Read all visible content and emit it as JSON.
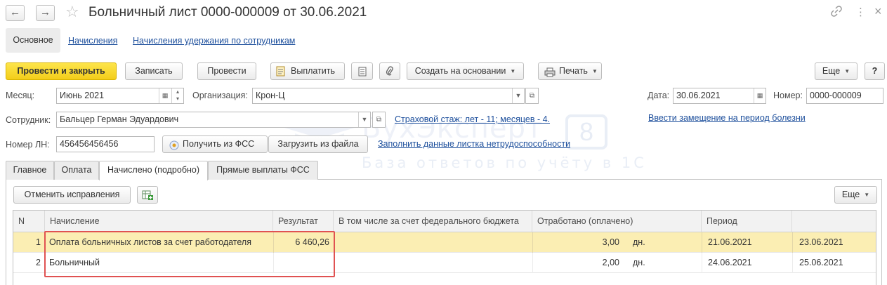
{
  "window": {
    "title": "Больничный лист 0000-000009 от 30.06.2021",
    "icons": [
      "back-arrow-icon",
      "forward-arrow-icon",
      "star-icon",
      "link-icon",
      "more-vertical-icon",
      "close-icon"
    ],
    "back_glyph": "←",
    "forward_glyph": "→",
    "star_glyph": "☆",
    "link_glyph": "🔗",
    "more_glyph": "⋮",
    "close_glyph": "×"
  },
  "sections": {
    "main": "Основное",
    "links": [
      "Начисления",
      "Начисления удержания по сотрудникам"
    ]
  },
  "toolbar": {
    "post_close": "Провести и закрыть",
    "save": "Записать",
    "post": "Провести",
    "pay": "Выплатить",
    "create_based": "Создать на основании",
    "print": "Печать",
    "more": "Еще",
    "help": "?"
  },
  "form": {
    "month_label": "Месяц:",
    "month_value": "Июнь 2021",
    "org_label": "Организация:",
    "org_value": "Крон-Ц",
    "date_label": "Дата:",
    "date_value": "30.06.2021",
    "number_label": "Номер:",
    "number_value": "0000-000009",
    "employee_label": "Сотрудник:",
    "employee_value": "Бальцер Герман Эдуардович",
    "insurance_link": "Страховой стаж: лет - 11; месяцев - 4.",
    "replacement_link": "Ввести замещение на период болезни",
    "ln_label": "Номер ЛН:",
    "ln_value": "456456456456",
    "get_fss": "Получить из ФСС",
    "load_file": "Загрузить из файла",
    "fill_link": "Заполнить данные листка нетрудоспособности"
  },
  "watermark": {
    "brand": "БухЭксперт",
    "tagline": "База ответов по учёту в 1С",
    "badge": "8"
  },
  "tabs": [
    "Главное",
    "Оплата",
    "Начислено (подробно)",
    "Прямые выплаты ФСС"
  ],
  "active_tab": "Начислено (подробно)",
  "tab_toolbar": {
    "cancel_corrections": "Отменить исправления",
    "more": "Еще"
  },
  "table": {
    "columns": [
      "N",
      "Начисление",
      "Результат",
      "В том числе за счет федерального бюджета",
      "Отработано (оплачено)",
      "Период",
      ""
    ],
    "rows": [
      {
        "n": "1",
        "accrual": "Оплата больничных листов за счет работодателя",
        "result": "6 460,26",
        "federal": "",
        "worked": "3,00",
        "unit": "дн.",
        "from": "21.06.2021",
        "to": "23.06.2021"
      },
      {
        "n": "2",
        "accrual": "Больничный",
        "result": "",
        "federal": "",
        "worked": "2,00",
        "unit": "дн.",
        "from": "24.06.2021",
        "to": "25.06.2021"
      }
    ]
  },
  "colors": {
    "accent_yellow": "#f5cf1e",
    "link_blue": "#1d4f9c",
    "selected_row": "#fbeeb3",
    "highlight_red": "#e05252"
  }
}
